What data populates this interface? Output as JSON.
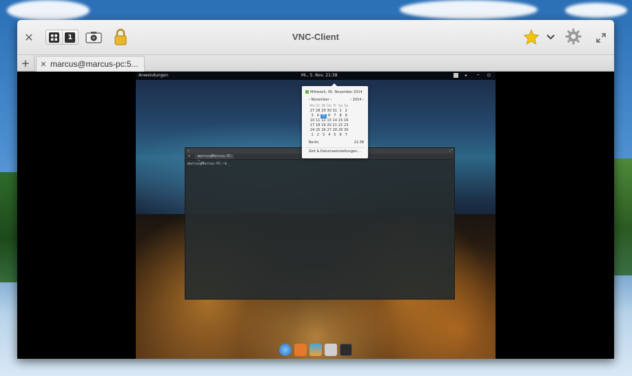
{
  "window": {
    "title": "VNC-Client"
  },
  "toolbar": {
    "group_btn_1_icon": "grid-icon",
    "group_btn_2_label": "1",
    "screenshot_icon": "camera-icon",
    "lock_icon": "lock-icon",
    "favorite_icon": "star-icon",
    "menu_icon": "chevron-down-icon",
    "settings_icon": "gear-icon",
    "fullscreen_icon": "expand-icon"
  },
  "tabs": {
    "add_label": "+",
    "items": [
      {
        "close": "✕",
        "label": "marcus@marcus-pc:5..."
      }
    ]
  },
  "remote": {
    "panel": {
      "apps_label": "Anwendungen",
      "clock": "Mi., 5. Nov.   21:38"
    },
    "calendar": {
      "date_heading": "Mittwoch, 05. November 2014",
      "month_nav": "‹ November ›",
      "year_nav": "‹ 2014 ›",
      "weekdays": [
        "Mo",
        "Di",
        "Mi",
        "Do",
        "Fr",
        "Sa",
        "So"
      ],
      "weeks": [
        [
          "27",
          "28",
          "29",
          "30",
          "31",
          "1",
          "2"
        ],
        [
          "3",
          "4",
          "5",
          "6",
          "7",
          "8",
          "9"
        ],
        [
          "10",
          "11",
          "12",
          "13",
          "14",
          "15",
          "16"
        ],
        [
          "17",
          "18",
          "19",
          "20",
          "21",
          "22",
          "23"
        ],
        [
          "24",
          "25",
          "26",
          "27",
          "28",
          "29",
          "30"
        ],
        [
          "1",
          "2",
          "3",
          "4",
          "5",
          "6",
          "7"
        ]
      ],
      "today": "5",
      "city": "Berlin",
      "city_time": "21:38",
      "settings_link": "Zeit & Datumseinstellungen..."
    },
    "terminal": {
      "tab_label": "marcus@Marcus-PC: ~",
      "prompt": "marcus@Marcus-PC:~$ _"
    }
  },
  "colors": {
    "titlebar": "#e8e8e8",
    "star": "#f1c40f",
    "today_highlight": "#3d8fd8"
  }
}
